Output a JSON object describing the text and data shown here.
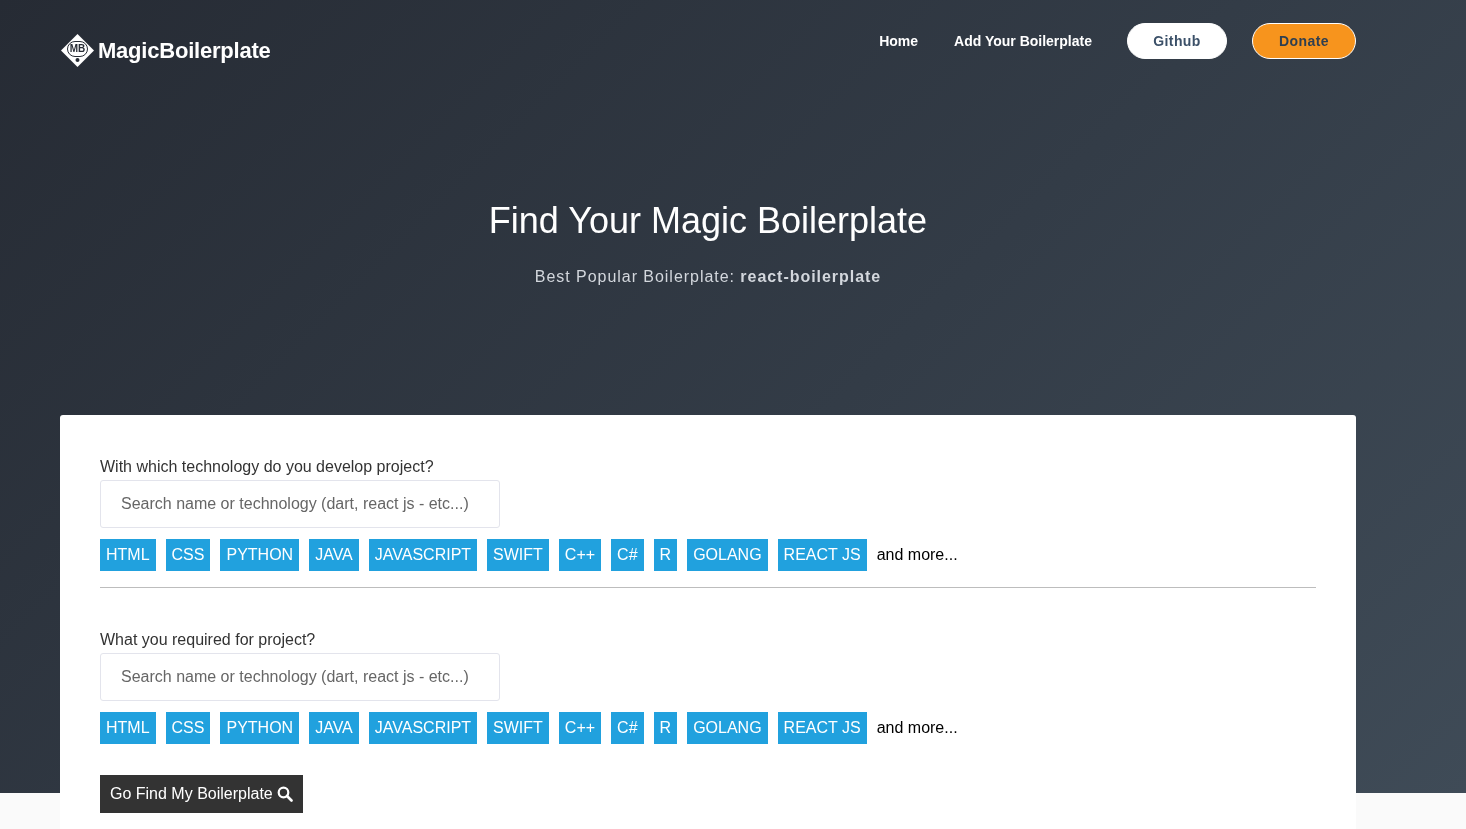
{
  "nav": {
    "logo": {
      "badge": "MB",
      "name": "MagicBoilerplate"
    },
    "links": [
      "Home",
      "Add Your Boilerplate"
    ],
    "buttons": [
      {
        "label": "Github",
        "kind": "light"
      },
      {
        "label": "Donate",
        "kind": "accent"
      }
    ]
  },
  "hero": {
    "title": "Find Your Magic Boilerplate",
    "subtitle": "Best Popular Boilerplate: **react-boilerplate**"
  },
  "form": {
    "sections": [
      {
        "label": "With which technology do you develop project?",
        "search": {
          "placeholder": "Search name or technology (dart, react js - etc...)"
        },
        "tags": [
          "HTML",
          "CSS",
          "PYTHON",
          "JAVA",
          "JAVASCRIPT",
          "SWIFT",
          "C++",
          "C#",
          "R",
          "GOLANG",
          "REACT JS"
        ],
        "more": "and more..."
      },
      {
        "label": "What you required for project?",
        "search": {
          "placeholder": "Search name or technology (dart, react js - etc...)"
        },
        "tags": [
          "HTML",
          "CSS",
          "PYTHON",
          "JAVA",
          "JAVASCRIPT",
          "SWIFT",
          "C++",
          "C#",
          "R",
          "GOLANG",
          "REACT JS"
        ],
        "more": "and more..."
      }
    ],
    "submit": "Go Find My Boilerplate"
  }
}
